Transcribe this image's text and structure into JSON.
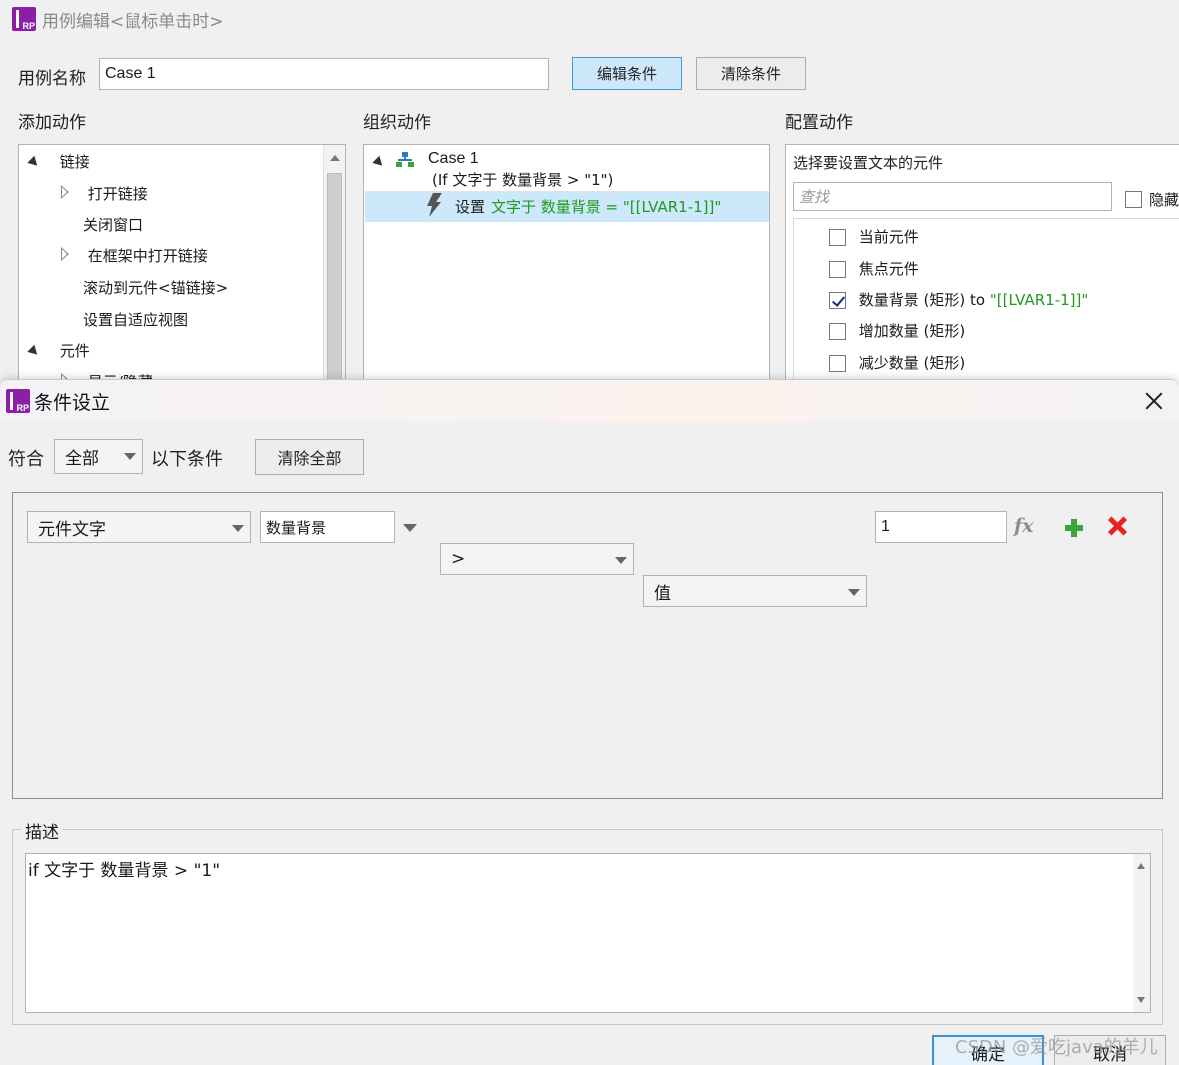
{
  "editor": {
    "title": "用例编辑<鼠标单击时>",
    "case_name_label": "用例名称",
    "case_name_value": "Case 1",
    "edit_condition_button": "编辑条件",
    "clear_condition_button": "清除条件",
    "add_action_header": "添加动作",
    "organize_action_header": "组织动作",
    "configure_action_header": "配置动作",
    "add_action_tree": [
      {
        "label": "链接"
      },
      {
        "label": "打开链接"
      },
      {
        "label": "关闭窗口"
      },
      {
        "label": "在框架中打开链接"
      },
      {
        "label": "滚动到元件<锚链接>"
      },
      {
        "label": "设置自适应视图"
      },
      {
        "label": "元件"
      },
      {
        "label": "显示/隐藏"
      }
    ],
    "organize": {
      "case_title": "Case 1",
      "case_condition": "(If 文字于 数量背景 > \"1\")",
      "action_prefix": "设置",
      "action_detail": "文字于 数量背景 = \"[[LVAR1-1]]\""
    },
    "configure": {
      "heading": "选择要设置文本的元件",
      "search_placeholder": "查找",
      "hide_label": "隐藏",
      "widgets": [
        {
          "label": "当前元件",
          "checked": false,
          "suffix": ""
        },
        {
          "label": "焦点元件",
          "checked": false,
          "suffix": ""
        },
        {
          "label": "数量背景 (矩形) to ",
          "checked": true,
          "suffix": "\"[[LVAR1-1]]\""
        },
        {
          "label": "增加数量 (矩形)",
          "checked": false,
          "suffix": ""
        },
        {
          "label": "减少数量 (矩形)",
          "checked": false,
          "suffix": ""
        }
      ]
    }
  },
  "dialog": {
    "title": "条件设立",
    "match_label": "符合",
    "match_value": "全部",
    "following_label": "以下条件",
    "clear_all_button": "清除全部",
    "condition": {
      "type": "元件文字",
      "widget": "数量背景",
      "operator": ">",
      "value_type": "值",
      "value": "1",
      "fx_label": "fx"
    },
    "description_legend": "描述",
    "description_text": "if 文字于 数量背景 > \"1\"",
    "ok_button": "确定",
    "cancel_button": "取消",
    "watermark": "CSDN @爱吃java的羊儿"
  },
  "colors": {
    "accent_green": "#1f9a1f",
    "selected_row": "#cde8fa",
    "logo_purple": "#8b1fa6",
    "delete_red": "#e52222",
    "add_green": "#3aa63a"
  }
}
